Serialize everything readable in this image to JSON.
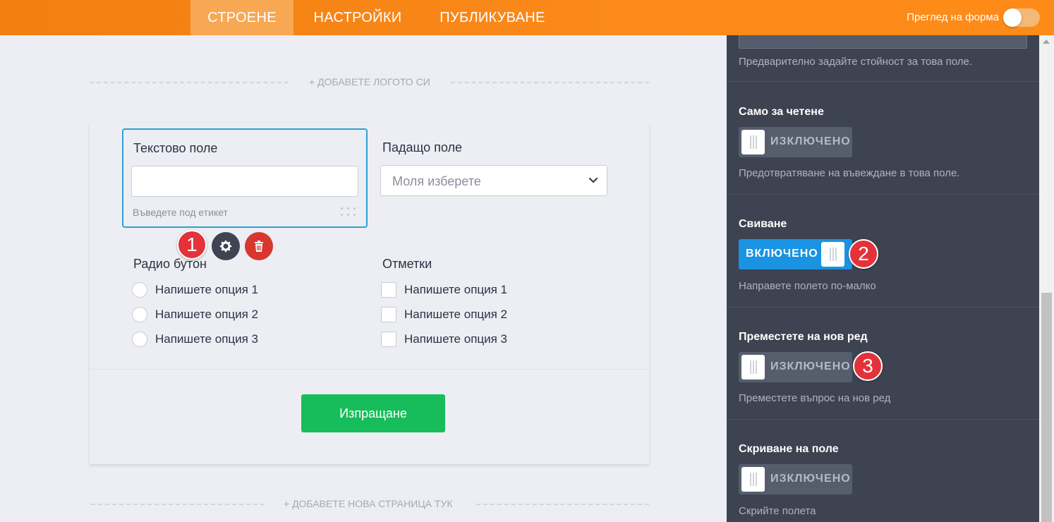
{
  "header": {
    "tabs": [
      {
        "label": "СТРОЕНЕ",
        "active": true
      },
      {
        "label": "НАСТРОЙКИ",
        "active": false
      },
      {
        "label": "ПУБЛИКУВАНЕ",
        "active": false
      }
    ],
    "preview_label": "Преглед на форма",
    "preview_enabled": false
  },
  "canvas": {
    "add_logo": "+ ДОБАВЕТЕ ЛОГОТО СИ",
    "add_page": "+ ДОБАВЕТЕ НОВА СТРАНИЦА ТУК",
    "text_field": {
      "label": "Текстово поле",
      "value": "",
      "sublabel": "Въведете под етикет"
    },
    "dropdown": {
      "label": "Падащо поле",
      "selected": "Моля изберете"
    },
    "radio": {
      "label": "Радио бутон",
      "options": [
        "Напишете опция 1",
        "Напишете опция 2",
        "Напишете опция 3"
      ]
    },
    "checkbox": {
      "label": "Отметки",
      "options": [
        "Напишете опция 1",
        "Напишете опция 2",
        "Напишете опция 3"
      ]
    },
    "submit_label": "Изпращане"
  },
  "badges": [
    "1",
    "2",
    "3"
  ],
  "panel": {
    "top_desc": "Предварително задайте стойност за това поле.",
    "settings": [
      {
        "title": "Само за четене",
        "state": "ИЗКЛЮЧЕНО",
        "on": false,
        "desc": "Предотвратяване на въвеждане в това поле."
      },
      {
        "title": "Свиване",
        "state": "ВКЛЮЧЕНО",
        "on": true,
        "desc": "Направете полето по-малко"
      },
      {
        "title": "Преместете на нов ред",
        "state": "ИЗКЛЮЧЕНО",
        "on": false,
        "desc": "Преместете въпрос на нов ред"
      },
      {
        "title": "Скриване на поле",
        "state": "ИЗКЛЮЧЕНО",
        "on": false,
        "desc": "Скрийте полета"
      }
    ]
  },
  "colors": {
    "brand_orange": "#fb8a1a",
    "selected_border": "#2e9fd9",
    "submit_green": "#18bd5b",
    "delete_red": "#d7372f",
    "toggle_on_blue": "#1a93e2",
    "panel_bg": "#3d4350",
    "badge_red": "#e4323a"
  },
  "icons": {
    "gear": "gear-icon",
    "trash": "trash-icon",
    "dropdown": "chevron-down-icon",
    "drag": "drag-handle-icon"
  }
}
